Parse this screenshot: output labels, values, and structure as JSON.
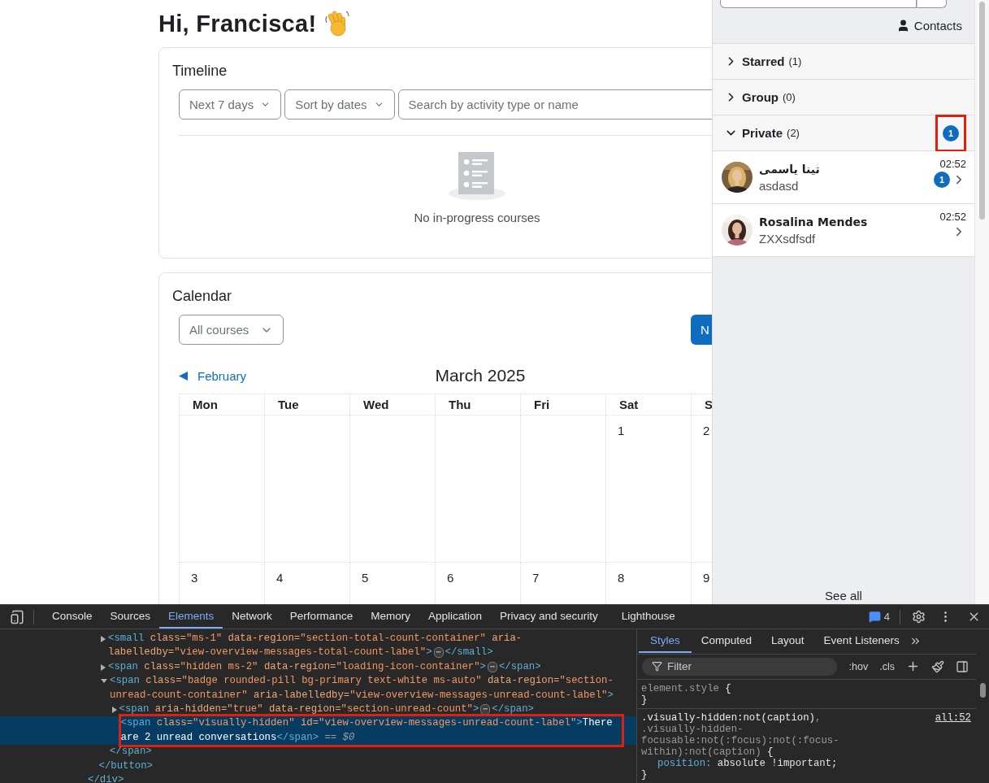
{
  "page": {
    "greeting": "Hi, Francisca!"
  },
  "timeline": {
    "title": "Timeline",
    "filters": [
      {
        "label": "Next 7 days"
      },
      {
        "label": "Sort by dates"
      }
    ],
    "search": {
      "placeholder": "Search by activity type or name"
    },
    "empty_message": "No in-progress courses"
  },
  "calendar": {
    "title": "Calendar",
    "course_select": "All courses",
    "new_event_button": "N",
    "prev_month": "February",
    "month": "March 2025",
    "weekdays": [
      "Mon",
      "Tue",
      "Wed",
      "Thu",
      "Fri",
      "Sat",
      "S"
    ],
    "weeks": [
      {
        "days": [
          "1",
          "2"
        ]
      },
      {
        "days": [
          "3",
          "4",
          "5",
          "6",
          "7",
          "8",
          "9"
        ]
      }
    ]
  },
  "drawer": {
    "contacts_link": "Contacts",
    "sections": [
      {
        "title": "Starred",
        "count": "(1)",
        "expanded": false
      },
      {
        "title": "Group",
        "count": "(0)",
        "expanded": false
      },
      {
        "title": "Private",
        "count": "(2)",
        "expanded": true,
        "unread": "1",
        "highlighted": true,
        "conversations": [
          {
            "name": "تینا یاسمی",
            "message": "asdasd",
            "time": "02:52",
            "unread": "1"
          },
          {
            "name": "Rosalina Mendes",
            "message": "ZXXsdfsdf",
            "time": "02:52"
          }
        ]
      }
    ],
    "see_all": "See all"
  },
  "devtools": {
    "tabs": [
      {
        "label": "Console",
        "selected": false
      },
      {
        "label": "Sources",
        "selected": false
      },
      {
        "label": "Elements",
        "selected": true
      },
      {
        "label": "Network",
        "selected": false
      },
      {
        "label": "Performance",
        "selected": false
      },
      {
        "label": "Memory",
        "selected": false
      },
      {
        "label": "Application",
        "selected": false
      },
      {
        "label": "Privacy and security",
        "selected": false
      },
      {
        "label": "Lighthouse",
        "selected": false
      }
    ],
    "issues_count": "4",
    "elements": [
      {
        "close": "</div>",
        "children": [
          {
            "close": "</button>",
            "children": [
              {
                "expanded": false,
                "selected": false,
                "highlighted": false,
                "tokens": [
                  {
                    "kind": "tag",
                    "text": "<small"
                  },
                  {
                    "kind": "attr",
                    "text": " class="
                  },
                  {
                    "kind": "value",
                    "text": "\"ms-1\""
                  },
                  {
                    "kind": "attr",
                    "text": " data-region="
                  },
                  {
                    "kind": "value",
                    "text": "\"section-total-count-container\""
                  },
                  {
                    "kind": "attr",
                    "text": " aria-labelledby="
                  },
                  {
                    "kind": "value",
                    "text": "\"view-overview-messages-total-count-label\""
                  },
                  {
                    "kind": "tag",
                    "text": ">"
                  },
                  {
                    "kind": "collapsed",
                    "text": "⋯"
                  },
                  {
                    "kind": "tag",
                    "text": "</small>"
                  }
                ]
              },
              {
                "expanded": false,
                "selected": false,
                "highlighted": false,
                "tokens": [
                  {
                    "kind": "tag",
                    "text": "<span"
                  },
                  {
                    "kind": "attr",
                    "text": " class="
                  },
                  {
                    "kind": "value",
                    "text": "\"hidden ms-2\""
                  },
                  {
                    "kind": "attr",
                    "text": " data-region="
                  },
                  {
                    "kind": "value",
                    "text": "\"loading-icon-container\""
                  },
                  {
                    "kind": "tag",
                    "text": ">"
                  },
                  {
                    "kind": "collapsed",
                    "text": "⋯"
                  },
                  {
                    "kind": "tag",
                    "text": "</span>"
                  }
                ]
              },
              {
                "expanded": true,
                "selected": false,
                "highlighted": false,
                "close": "</span>",
                "tokens": [
                  {
                    "kind": "tag",
                    "text": "<span"
                  },
                  {
                    "kind": "attr",
                    "text": " class="
                  },
                  {
                    "kind": "value",
                    "text": "\"badge rounded-pill bg-primary text-white ms-auto\""
                  },
                  {
                    "kind": "attr",
                    "text": " data-region="
                  },
                  {
                    "kind": "value",
                    "text": "\"section-unread-count-container\""
                  },
                  {
                    "kind": "attr",
                    "text": " aria-labelledby="
                  },
                  {
                    "kind": "value",
                    "text": "\"view-overview-messages-unread-count-label\""
                  },
                  {
                    "kind": "tag",
                    "text": ">"
                  }
                ],
                "children": [
                  {
                    "expanded": false,
                    "selected": false,
                    "highlighted": false,
                    "tokens": [
                      {
                        "kind": "tag",
                        "text": "<span"
                      },
                      {
                        "kind": "attr",
                        "text": " aria-hidden="
                      },
                      {
                        "kind": "value",
                        "text": "\"true\""
                      },
                      {
                        "kind": "attr",
                        "text": " data-region="
                      },
                      {
                        "kind": "value",
                        "text": "\"section-unread-count\""
                      },
                      {
                        "kind": "tag",
                        "text": ">"
                      },
                      {
                        "kind": "collapsed",
                        "text": "⋯"
                      },
                      {
                        "kind": "tag",
                        "text": "</span>"
                      }
                    ]
                  },
                  {
                    "selected": true,
                    "highlighted": true,
                    "tokens": [
                      {
                        "kind": "tag",
                        "text": "<span"
                      },
                      {
                        "kind": "attr",
                        "text": " class="
                      },
                      {
                        "kind": "value",
                        "text": "\"visually-hidden\""
                      },
                      {
                        "kind": "attr",
                        "text": " id="
                      },
                      {
                        "kind": "value",
                        "text": "\"view-overview-messages-unread-count-label\""
                      },
                      {
                        "kind": "tag",
                        "text": ">"
                      },
                      {
                        "kind": "text",
                        "text": "There are 2 unread conversations"
                      },
                      {
                        "kind": "tag",
                        "text": "</span>"
                      },
                      {
                        "kind": "marker",
                        "text": " == $0"
                      }
                    ]
                  }
                ]
              }
            ]
          }
        ]
      }
    ],
    "styles": {
      "tabs": [
        {
          "label": "Styles",
          "selected": true
        },
        {
          "label": "Computed",
          "selected": false
        },
        {
          "label": "Layout",
          "selected": false
        },
        {
          "label": "Event Listeners",
          "selected": false
        }
      ],
      "filter_placeholder": "Filter",
      "toggles": [
        ":hov",
        ".cls"
      ],
      "rules": [
        {
          "selectors": [
            {
              "text": "element.style",
              "matched": false
            },
            {
              "text": " {",
              "matched": true
            }
          ],
          "close": "}"
        },
        {
          "selectors": [
            {
              "text": ".visually-hidden:not(caption)",
              "matched": true
            },
            {
              "text": ", .visually-hidden-focusable:not(:focus):not(:focus-within):not(caption)",
              "matched": false
            },
            {
              "text": " {",
              "matched": true
            }
          ],
          "source": "all:52",
          "properties": [
            {
              "name": "position:",
              "value": "absolute !important;"
            }
          ],
          "close": "}"
        }
      ]
    }
  }
}
